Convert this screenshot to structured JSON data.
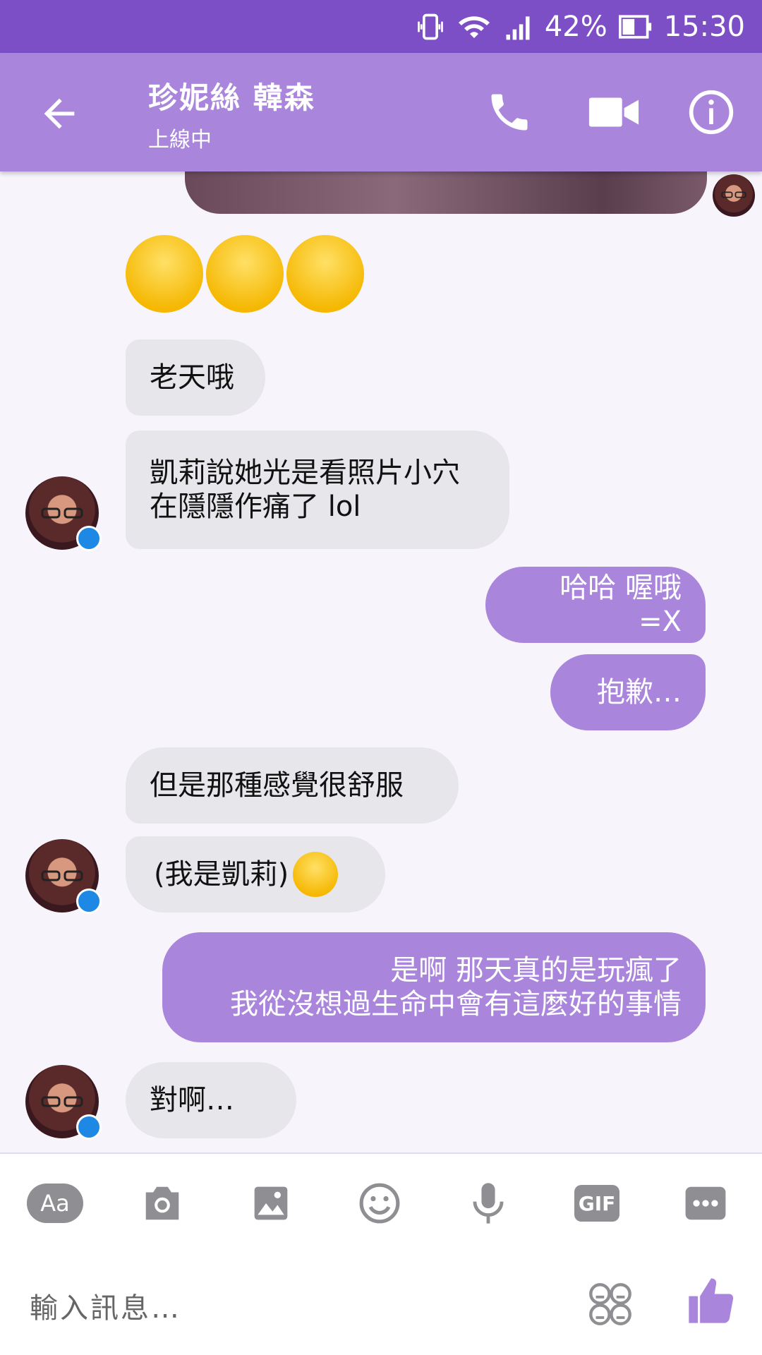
{
  "status_bar": {
    "battery": "42%",
    "time": "15:30"
  },
  "header": {
    "contact_name": "珍妮絲 韓森",
    "contact_status": "上線中"
  },
  "messages": [
    {
      "dir": "in",
      "text": "老天哦"
    },
    {
      "dir": "in",
      "text": "凱莉說她光是看照片小穴",
      "text2": "在隱隱作痛了 lol"
    },
    {
      "dir": "out",
      "text": "哈哈 喔哦 =X"
    },
    {
      "dir": "out",
      "text": "抱歉…"
    },
    {
      "dir": "in",
      "text": "但是那種感覺很舒服"
    },
    {
      "dir": "in",
      "text": "(我是凱莉)"
    },
    {
      "dir": "out",
      "text": "是啊 那天真的是玩瘋了",
      "text2": "我從沒想過生命中會有這麼好的事情"
    },
    {
      "dir": "in",
      "text": "對啊…"
    }
  ],
  "toolbar": {
    "items": [
      "text-format-icon",
      "camera-icon",
      "image-icon",
      "emoji-icon",
      "microphone-icon",
      "gif-icon",
      "more-icon"
    ],
    "aa_label": "Aa",
    "gif_label": "GIF"
  },
  "compose": {
    "placeholder": "輸入訊息…"
  },
  "colors": {
    "status_bar": "#7d4fc6",
    "header": "#a985dc",
    "outgoing": "#a985dc",
    "incoming": "#e7e6eb"
  }
}
